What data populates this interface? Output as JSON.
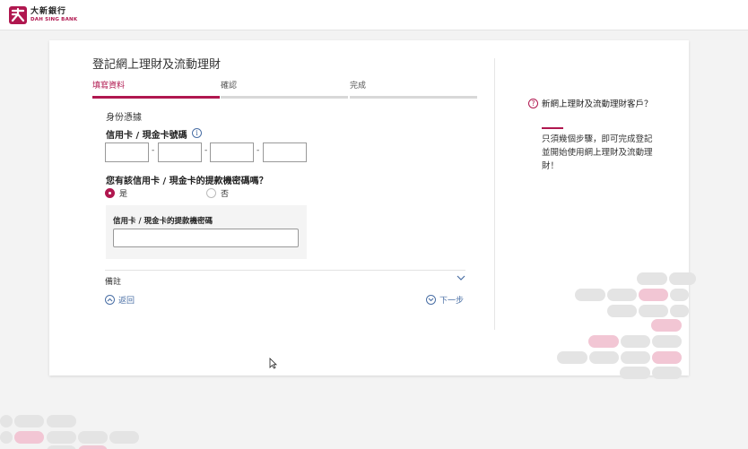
{
  "brand": {
    "name_cn": "大新銀行",
    "name_en": "DAH SING BANK",
    "accent": "#b0174f"
  },
  "page": {
    "title": "登記網上理財及流動理財"
  },
  "steps": [
    {
      "label": "填寫資料",
      "active": true
    },
    {
      "label": "確認",
      "active": false
    },
    {
      "label": "完成",
      "active": false
    }
  ],
  "form": {
    "section_title": "身份憑據",
    "card_number_label": "信用卡 / 現金卡號碼",
    "card_number_values": [
      "",
      "",
      "",
      ""
    ],
    "card_number_separator": "-",
    "info_icon": "info-icon",
    "pin_question": "您有該信用卡 / 現金卡的提款機密碼嗎？",
    "options": [
      {
        "label": "是",
        "selected": true
      },
      {
        "label": "否",
        "selected": false
      }
    ],
    "pin_label": "信用卡 / 現金卡的提款機密碼",
    "pin_value": ""
  },
  "remarks": {
    "label": "備註",
    "icon": "chevron-down-icon"
  },
  "nav": {
    "back_label": "返回",
    "back_icon": "chevron-up-circle-icon",
    "next_label": "下一步",
    "next_icon": "chevron-down-circle-icon"
  },
  "sidebar": {
    "icon": "question-icon",
    "icon_glyph": "?",
    "title": "新網上理財及流動理財客戶？",
    "description": "只須幾個步驟，即可完成登記並開始使用網上理財及流動理財！"
  }
}
